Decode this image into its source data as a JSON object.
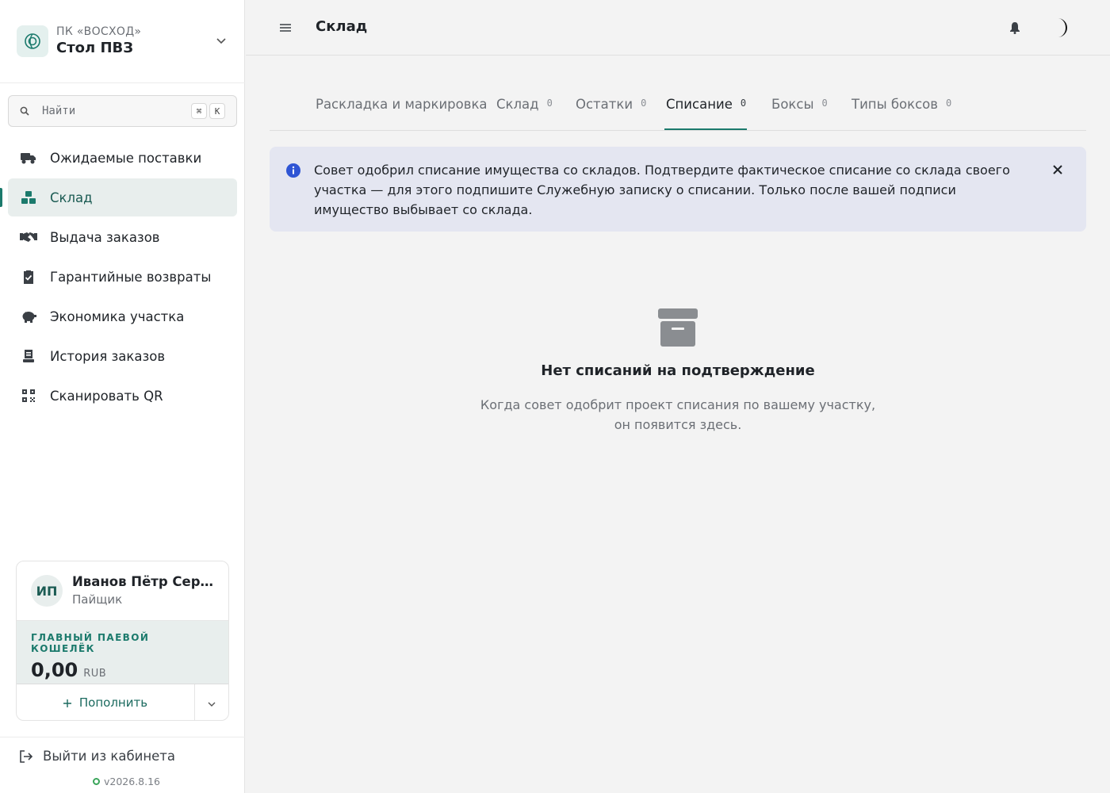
{
  "org": {
    "subtitle": "ПК «ВОСХОД»",
    "name": "Стол ПВЗ"
  },
  "search": {
    "placeholder": "Найти",
    "shortcut_mod": "⌘",
    "shortcut_key": "K"
  },
  "nav": [
    {
      "label": "Ожидаемые поставки",
      "icon": "truck-icon",
      "active": false
    },
    {
      "label": "Склад",
      "icon": "boxes-icon",
      "active": true
    },
    {
      "label": "Выдача заказов",
      "icon": "handshake-icon",
      "active": false
    },
    {
      "label": "Гарантийные возвраты",
      "icon": "clipboard-check-icon",
      "active": false
    },
    {
      "label": "Экономика участка",
      "icon": "piggy-bank-icon",
      "active": false
    },
    {
      "label": "История заказов",
      "icon": "receipt-icon",
      "active": false
    },
    {
      "label": "Сканировать QR",
      "icon": "qr-code-icon",
      "active": false
    }
  ],
  "user": {
    "initials": "ИП",
    "name": "Иванов Пётр Сергеевич",
    "role": "Пайщик",
    "wallet_label": "ГЛАВНЫЙ ПАЕВОЙ КОШЕЛЁК",
    "wallet_value": "0,00",
    "wallet_currency": "RUB",
    "topup_label": "Пополнить"
  },
  "footer": {
    "logout_label": "Выйти из кабинета",
    "version": "v2026.8.16"
  },
  "header": {
    "title": "Склад"
  },
  "tabs": [
    {
      "label": "Раскладка и маркировка",
      "count": ""
    },
    {
      "label": "Склад",
      "count": "0"
    },
    {
      "label": "Остатки",
      "count": "0"
    },
    {
      "label": "Списание",
      "count": "0"
    },
    {
      "label": "Боксы",
      "count": "0"
    },
    {
      "label": "Типы боксов",
      "count": "0"
    }
  ],
  "active_tab": "Списание",
  "alert": {
    "text": "Совет одобрил списание имущества со складов. Подтвердите фактическое списание со склада своего участка — для этого подпишите Служебную записку о списании. Только после вашей подписи имущество выбывает со склада."
  },
  "empty_state": {
    "title": "Нет списаний на подтверждение",
    "text": "Когда совет одобрит проект списания по вашему участку, он появится здесь."
  },
  "colors": {
    "accent": "#1b7a6c",
    "alert_bg": "#e4e6f1",
    "info_icon": "#2f55d4",
    "version_dot": "#3aa55a"
  }
}
